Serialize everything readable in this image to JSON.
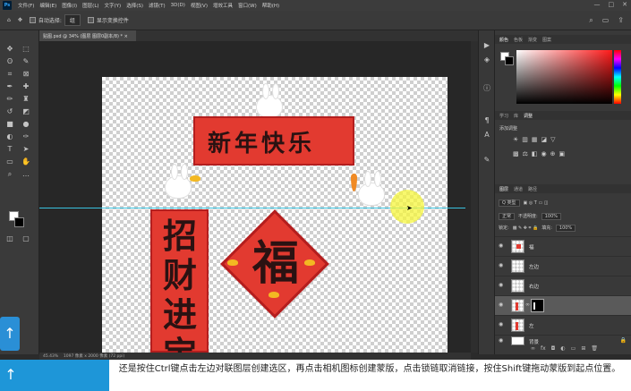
{
  "app": {
    "logo": "Ps"
  },
  "menu": [
    "文件(F)",
    "编辑(E)",
    "图像(I)",
    "图层(L)",
    "文字(Y)",
    "选择(S)",
    "滤镜(T)",
    "3D(D)",
    "视图(V)",
    "增效工具",
    "窗口(W)",
    "帮助(H)"
  ],
  "window_controls": [
    "—",
    "□",
    "✕"
  ],
  "options": {
    "auto_select": "自动选择:",
    "auto_select_value": "组",
    "show_transform": "显示变换控件"
  },
  "document_tab": {
    "title": "贴图.psd @ 34% (图层 图层0副本/8) *",
    "close": "×"
  },
  "status": {
    "zoom": "45.43%",
    "dims": "1097 像素 x 2000 像素 (72 ppi)"
  },
  "color_panel": {
    "tab_color": "颜色",
    "tab_swatches": "色板",
    "tab_gradient": "渐变",
    "tab_pattern": "图案"
  },
  "adjustments": {
    "tab_learn": "学习",
    "tab_libraries": "库",
    "tab_adjust": "调整",
    "title": "添加调整"
  },
  "layers_panel": {
    "tab_layers": "图层",
    "tab_channels": "通道",
    "tab_paths": "路径",
    "kind": "Q 类型",
    "blend": "正常",
    "opacity_label": "不透明度:",
    "opacity": "100%",
    "lock_label": "锁定:",
    "fill_label": "填充:",
    "fill": "100%",
    "layers": [
      {
        "name": "福"
      },
      {
        "name": "左边"
      },
      {
        "name": "右边"
      },
      {
        "name": ""
      },
      {
        "name": "左"
      },
      {
        "name": "背景"
      }
    ]
  },
  "artwork": {
    "banner": "新年快乐",
    "vertical": "招财进宝",
    "fu": "福"
  },
  "caption": "还是按住Ctrl键点击左边对联图层创建选区，再点击相机图标创建蒙版，点击锁链取消链接，按住Shift键拖动蒙版到起点位置。",
  "colors": {
    "accent_red": "#e23a30",
    "guide": "#39c3e0",
    "caption_blue": "#1e96d8"
  },
  "icons": [
    "move-tool-icon",
    "marquee-tool-icon",
    "lasso-tool-icon",
    "crop-tool-icon",
    "eyedropper-tool-icon",
    "brush-tool-icon",
    "eraser-tool-icon",
    "gradient-tool-icon",
    "pen-tool-icon",
    "type-tool-icon",
    "hand-tool-icon",
    "zoom-tool-icon",
    "eye-icon",
    "chain-icon",
    "lock-icon"
  ]
}
